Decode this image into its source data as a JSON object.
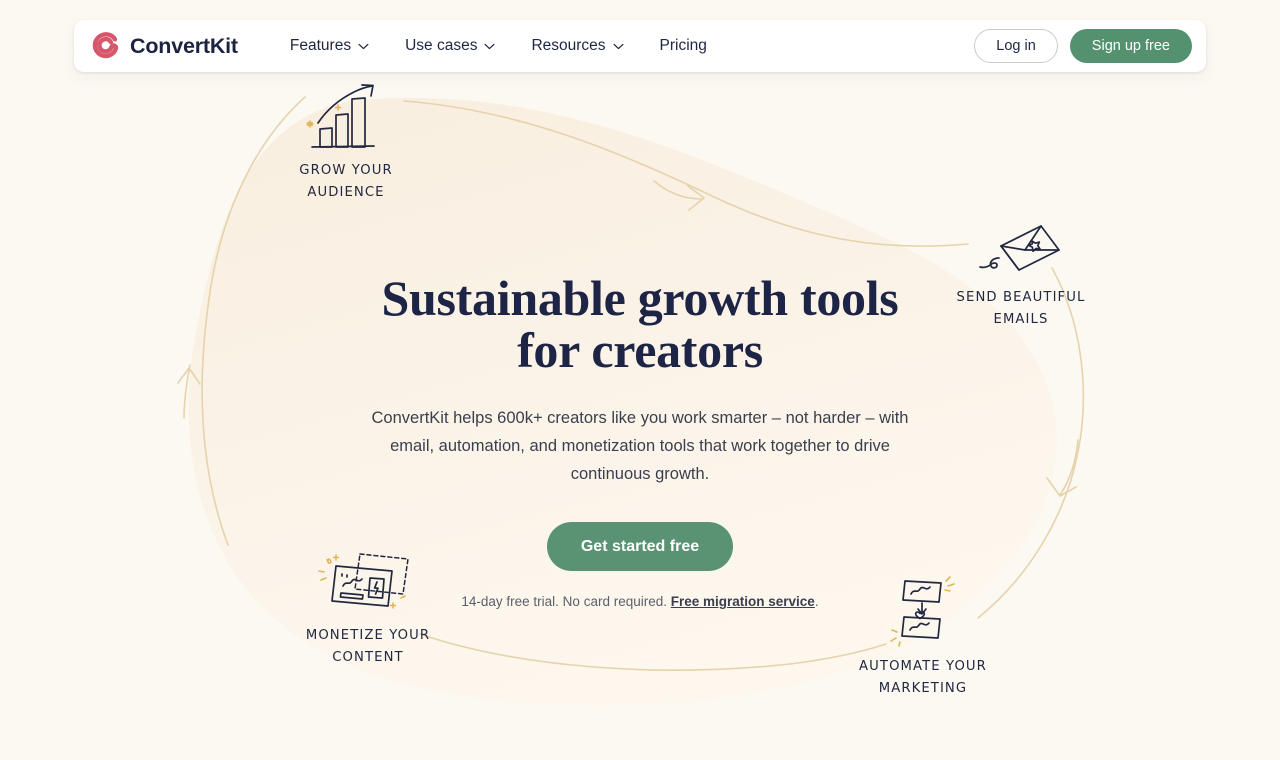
{
  "brand": {
    "name": "ConvertKit",
    "logo_icon": "convertkit-circle-logo",
    "logo_color": "#d6566a"
  },
  "nav": {
    "items": [
      {
        "label": "Features",
        "has_dropdown": true,
        "icon": "chevron-down-icon"
      },
      {
        "label": "Use cases",
        "has_dropdown": true,
        "icon": "chevron-down-icon"
      },
      {
        "label": "Resources",
        "has_dropdown": true,
        "icon": "chevron-down-icon"
      },
      {
        "label": "Pricing",
        "has_dropdown": false,
        "icon": ""
      }
    ],
    "login_label": "Log in",
    "signup_label": "Sign up free"
  },
  "hero": {
    "title_line_1": "Sustainable growth tools",
    "title_line_2": "for creators",
    "subtitle": "ConvertKit helps 600k+ creators like you work smarter – not harder – with email, automation, and monetization tools that work together to drive continuous growth.",
    "cta_label": "Get started free",
    "note_prefix": "14-day free trial. No card required. ",
    "note_link": "Free migration service",
    "note_suffix": "."
  },
  "callouts": [
    {
      "id": "grow",
      "label": "GROW YOUR\nAUDIENCE",
      "icon": "bar-chart-growth-icon"
    },
    {
      "id": "emails",
      "label": "SEND BEAUTIFUL\nEMAILS",
      "icon": "envelope-icon"
    },
    {
      "id": "automate",
      "label": "AUTOMATE YOUR\nMARKETING",
      "icon": "automation-boxes-icon"
    },
    {
      "id": "monetize",
      "label": "MONETIZE YOUR\nCONTENT",
      "icon": "product-card-icon"
    }
  ],
  "colors": {
    "page_background": "#fcf9f3",
    "blob_fill": "#faf1e4",
    "accent_green": "#54916f",
    "cta_green": "#5a9274",
    "heading_navy": "#1e2445",
    "doodle_line": "#22283f",
    "flow_line": "#e3cfa7",
    "brand_red": "#d6566a"
  }
}
